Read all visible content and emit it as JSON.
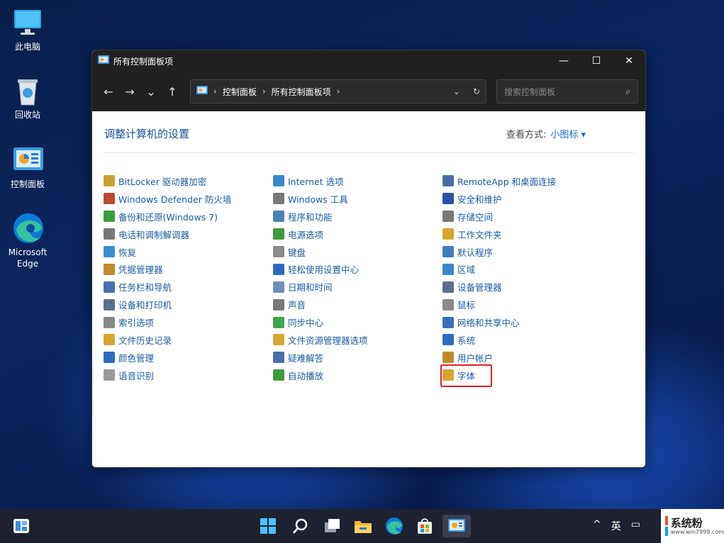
{
  "desktop": {
    "icons": [
      {
        "label": "此电脑",
        "icon": "monitor-icon"
      },
      {
        "label": "回收站",
        "icon": "recycle-bin-icon"
      },
      {
        "label": "控制面板",
        "icon": "control-panel-icon"
      },
      {
        "label": "Microsoft Edge",
        "icon": "edge-icon"
      }
    ]
  },
  "window": {
    "title": "所有控制面板项",
    "controls": {
      "minimize": "—",
      "maximize": "☐",
      "close": "✕"
    },
    "nav": {
      "back": "←",
      "forward": "→",
      "recent": "⌄",
      "up": "↑"
    },
    "address": {
      "sep": "›",
      "crumbs": [
        "控制面板",
        "所有控制面板项"
      ],
      "dropdown": "⌄",
      "refresh": "↻"
    },
    "search": {
      "placeholder": "搜索控制面板",
      "icon": "⌕"
    },
    "heading": "调整计算机的设置",
    "view_by": {
      "label": "查看方式:",
      "value": "小图标 ▾"
    },
    "columns": [
      [
        {
          "label": "BitLocker 驱动器加密",
          "icon": "bitlocker-icon",
          "color": "#c9a13b"
        },
        {
          "label": "Windows Defender 防火墙",
          "icon": "firewall-icon",
          "color": "#b94a2d"
        },
        {
          "label": "备份和还原(Windows 7)",
          "icon": "backup-icon",
          "color": "#3f9b3f"
        },
        {
          "label": "电话和调制解调器",
          "icon": "phone-modem-icon",
          "color": "#777777"
        },
        {
          "label": "恢复",
          "icon": "recovery-icon",
          "color": "#3a8fd3"
        },
        {
          "label": "凭据管理器",
          "icon": "credential-icon",
          "color": "#c08a2a"
        },
        {
          "label": "任务栏和导航",
          "icon": "taskbar-icon",
          "color": "#4a6ea8"
        },
        {
          "label": "设备和打印机",
          "icon": "printer-icon",
          "color": "#5c6f88"
        },
        {
          "label": "索引选项",
          "icon": "index-icon",
          "color": "#888888"
        },
        {
          "label": "文件历史记录",
          "icon": "file-history-icon",
          "color": "#d7a531"
        },
        {
          "label": "颜色管理",
          "icon": "color-management-icon",
          "color": "#2f6bbd"
        },
        {
          "label": "语音识别",
          "icon": "microphone-icon",
          "color": "#9a9a9a"
        }
      ],
      [
        {
          "label": "Internet 选项",
          "icon": "internet-icon",
          "color": "#3b86c9"
        },
        {
          "label": "Windows 工具",
          "icon": "tools-icon",
          "color": "#7a7a7a"
        },
        {
          "label": "程序和功能",
          "icon": "programs-icon",
          "color": "#4f7fb8"
        },
        {
          "label": "电源选项",
          "icon": "power-icon",
          "color": "#3f9b3f"
        },
        {
          "label": "键盘",
          "icon": "keyboard-icon",
          "color": "#8a8a8a"
        },
        {
          "label": "轻松使用设置中心",
          "icon": "ease-of-access-icon",
          "color": "#2f6bbd"
        },
        {
          "label": "日期和时间",
          "icon": "calendar-icon",
          "color": "#6f8fb8"
        },
        {
          "label": "声音",
          "icon": "speaker-icon",
          "color": "#7a7a7a"
        },
        {
          "label": "同步中心",
          "icon": "sync-icon",
          "color": "#3fa84a"
        },
        {
          "label": "文件资源管理器选项",
          "icon": "folder-options-icon",
          "color": "#d7a531"
        },
        {
          "label": "疑难解答",
          "icon": "troubleshoot-icon",
          "color": "#4a6ea8"
        },
        {
          "label": "自动播放",
          "icon": "autoplay-icon",
          "color": "#3f9b3f"
        }
      ],
      [
        {
          "label": "RemoteApp 和桌面连接",
          "icon": "remoteapp-icon",
          "color": "#4a6ea8"
        },
        {
          "label": "安全和维护",
          "icon": "flag-icon",
          "color": "#2f4fa8"
        },
        {
          "label": "存储空间",
          "icon": "storage-icon",
          "color": "#7a7a7a"
        },
        {
          "label": "工作文件夹",
          "icon": "work-folders-icon",
          "color": "#d7a531"
        },
        {
          "label": "默认程序",
          "icon": "default-programs-icon",
          "color": "#3f7fc0"
        },
        {
          "label": "区域",
          "icon": "region-icon",
          "color": "#3b86c9"
        },
        {
          "label": "设备管理器",
          "icon": "device-manager-icon",
          "color": "#5c6f88"
        },
        {
          "label": "鼠标",
          "icon": "mouse-icon",
          "color": "#8a8a8a"
        },
        {
          "label": "网络和共享中心",
          "icon": "network-icon",
          "color": "#3b6fb8"
        },
        {
          "label": "系统",
          "icon": "system-icon",
          "color": "#2f6bbd"
        },
        {
          "label": "用户帐户",
          "icon": "user-accounts-icon",
          "color": "#c08a2a"
        },
        {
          "label": "字体",
          "icon": "fonts-icon",
          "color": "#d7a531"
        }
      ]
    ]
  },
  "taskbar": {
    "items": [
      "widgets-icon",
      "start-icon",
      "search-icon",
      "task-view-icon",
      "file-explorer-icon",
      "edge-icon",
      "store-icon",
      "control-panel-icon"
    ],
    "tray": {
      "chevron": "^",
      "ime": "英"
    }
  },
  "watermark": {
    "title": "系统粉",
    "url": "www.win7999.com"
  }
}
